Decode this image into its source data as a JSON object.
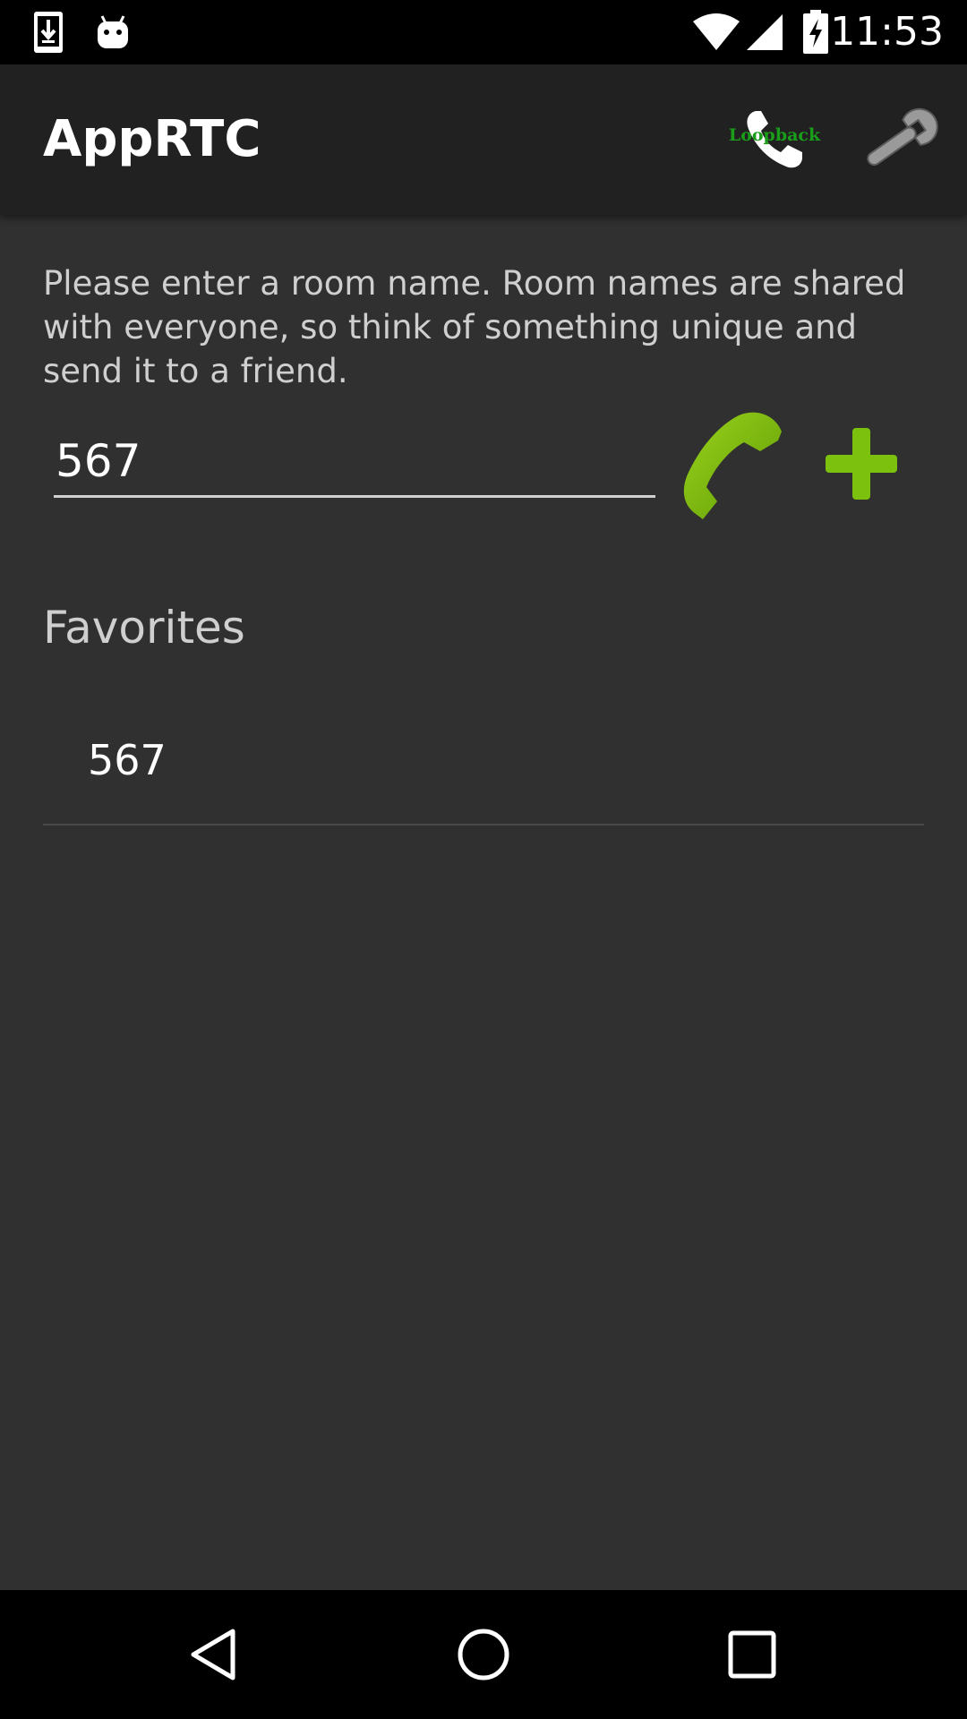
{
  "status_bar": {
    "time": "11:53",
    "icons": [
      "download-icon",
      "android-icon",
      "wifi-icon",
      "signal-icon",
      "battery-charging-icon"
    ]
  },
  "action_bar": {
    "title": "AppRTC",
    "loopback_label": "Loopback",
    "icons": [
      "phone-icon",
      "wrench-icon"
    ]
  },
  "content": {
    "instructions": "Please enter a room name. Room names are shared with everyone, so think of something unique and send it to a friend.",
    "room_input_value": "567",
    "favorites_header": "Favorites",
    "favorites": [
      {
        "label": "567"
      }
    ]
  },
  "nav_bar": {
    "icons": [
      "back-icon",
      "home-icon",
      "recents-icon"
    ]
  },
  "colors": {
    "background": "#303030",
    "action_bar": "#212121",
    "accent_green": "#7cc10e",
    "loopback_text": "#1a9e1a"
  }
}
